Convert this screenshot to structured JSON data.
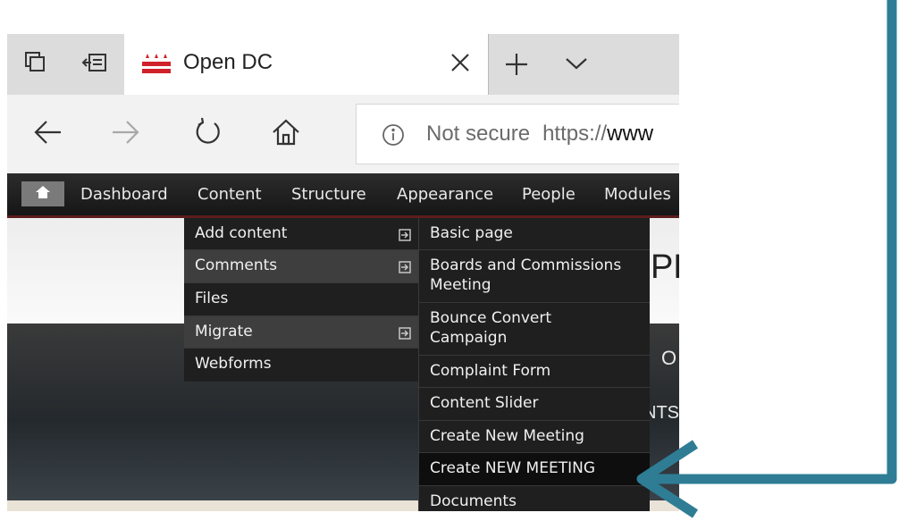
{
  "browser": {
    "tab_title": "Open DC",
    "address": {
      "security_text": "Not secure",
      "url_scheme": "https://",
      "url_host": "www"
    }
  },
  "admin_toolbar": {
    "items": [
      "Dashboard",
      "Content",
      "Structure",
      "Appearance",
      "People",
      "Modules"
    ]
  },
  "content_menu": {
    "items": [
      {
        "label": "Add content",
        "has_submenu": true
      },
      {
        "label": "Comments",
        "has_submenu": true
      },
      {
        "label": "Files",
        "has_submenu": false
      },
      {
        "label": "Migrate",
        "has_submenu": true
      },
      {
        "label": "Webforms",
        "has_submenu": false
      }
    ]
  },
  "add_content_submenu": {
    "items": [
      "Basic page",
      "Boards and Commissions Meeting",
      "Bounce Convert Campaign",
      "Complaint Form",
      "Content Slider",
      "Create New Meeting",
      "Create NEW MEETING",
      "Documents"
    ],
    "selected": "Create NEW MEETING"
  },
  "page_peek": {
    "header_text": "PE",
    "dark_text_1": "O",
    "dark_text_2": "NTS"
  },
  "annotation": {
    "arrow_color": "#2e7d94"
  },
  "icons": {
    "tab_actions": "tab-stack-icon",
    "set_aside": "set-aside-tabs-icon",
    "favicon": "dc-flag-icon",
    "close": "close-icon",
    "new_tab": "plus-icon",
    "tab_menu": "chevron-down-icon",
    "back": "arrow-left-icon",
    "forward": "arrow-right-icon",
    "refresh": "refresh-icon",
    "home": "home-icon",
    "info": "info-icon",
    "submenu": "submenu-arrow-icon"
  },
  "colors": {
    "toolbar_bg": "#1c1c1c",
    "toolbar_border": "#5e1c1c",
    "menu_bg": "#1f1f1f",
    "menu_highlight": "#3e3e3e"
  }
}
